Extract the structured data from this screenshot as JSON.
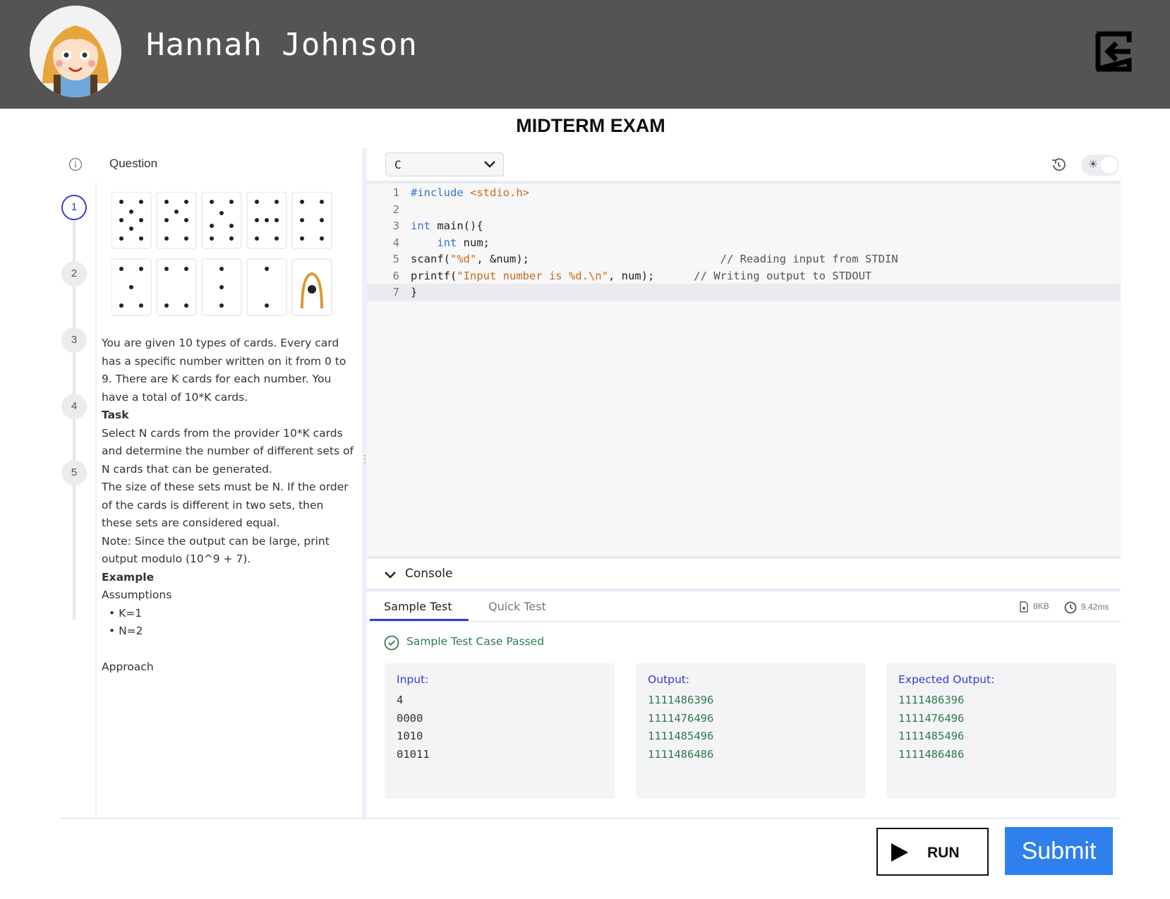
{
  "header": {
    "user_name": "Hannah  Johnson",
    "background_color": "#545454",
    "avatar_icon": "girl-avatar-icon",
    "logout_icon": "logout-icon"
  },
  "exam": {
    "title": "MIDTERM EXAM"
  },
  "left_panel": {
    "tab_label": "Question",
    "info_icon": "info-icon",
    "steps": [
      "1",
      "2",
      "3",
      "4",
      "5"
    ],
    "active_step": "1",
    "question": {
      "intro": "You are given 10 types of cards. Every card has a specific number written on it from 0 to 9. There are K cards for each number. You have a total of 10*K cards.",
      "task_heading": "Task",
      "task_text": "Select N cards from the provider 10*K cards and determine the number of different sets of N cards that can be generated.",
      "size_text": "The size of these sets must be N. If the order of the cards is different in two sets, then these sets are considered equal.",
      "note_text": "Note: Since the output can be large, print output modulo (10^9 + 7).",
      "example_heading": "Example",
      "assumptions_heading": "Assumptions",
      "assumptions": [
        "K=1",
        "N=2"
      ],
      "approach_heading": "Approach"
    }
  },
  "editor": {
    "language": "C",
    "history_icon": "history-icon",
    "theme_icon": "sun-icon",
    "current_line": 7,
    "lines": [
      {
        "num": "1",
        "parts": [
          {
            "text": "#include ",
            "cls": "c-blue"
          },
          {
            "text": "<stdio.h>",
            "cls": "c-orange"
          }
        ]
      },
      {
        "num": "2",
        "parts": []
      },
      {
        "num": "3",
        "parts": [
          {
            "text": "int",
            "cls": "c-blue"
          },
          {
            "text": " main(){",
            "cls": ""
          }
        ]
      },
      {
        "num": "4",
        "parts": [
          {
            "text": "    ",
            "cls": ""
          },
          {
            "text": "int",
            "cls": "c-blue"
          },
          {
            "text": " num;",
            "cls": ""
          }
        ]
      },
      {
        "num": "5",
        "parts": [
          {
            "text": "scanf(",
            "cls": ""
          },
          {
            "text": "\"%d\"",
            "cls": "c-orange"
          },
          {
            "text": ", &num);                             ",
            "cls": ""
          },
          {
            "text": "// Reading input from STDIN",
            "cls": "c-comment"
          }
        ]
      },
      {
        "num": "6",
        "parts": [
          {
            "text": "printf(",
            "cls": ""
          },
          {
            "text": "\"Input number is %d.\\n\"",
            "cls": "c-orange"
          },
          {
            "text": ", num);      ",
            "cls": ""
          },
          {
            "text": "// Writing output to STDOUT",
            "cls": "c-comment"
          }
        ]
      },
      {
        "num": "7",
        "parts": [
          {
            "text": "}",
            "cls": ""
          }
        ]
      }
    ]
  },
  "console": {
    "label": "Console",
    "tabs": [
      "Sample Test",
      "Quick Test"
    ],
    "active_tab": "Sample Test",
    "memory": "8KB",
    "runtime": "9.42ms",
    "status": "Sample Test Case Passed",
    "status_color": "#2f7a4d",
    "input": {
      "label": "Input:",
      "values": [
        "4",
        "0000",
        "1010",
        "01011"
      ]
    },
    "output": {
      "label": "Output:",
      "values": [
        "1111486396",
        "1111476496",
        "1111485496",
        "1111486486"
      ]
    },
    "expected": {
      "label": "Expected Output:",
      "values": [
        "1111486396",
        "1111476496",
        "1111485496",
        "1111486486"
      ]
    }
  },
  "actions": {
    "run_label": "RUN",
    "submit_label": "Submit",
    "submit_color": "#2f80ed"
  }
}
